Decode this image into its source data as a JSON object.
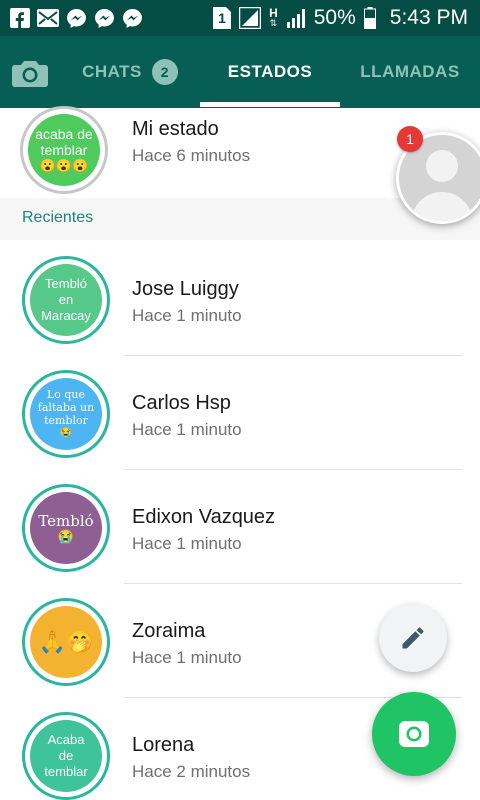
{
  "status_bar": {
    "battery_percent": "50%",
    "time": "5:43 PM",
    "sim_label": "1",
    "network_label": "H",
    "icons": [
      "facebook-icon",
      "mail-icon",
      "messenger-icon",
      "messenger-icon",
      "messenger-icon",
      "sim-icon",
      "signal-icon",
      "signal-icon",
      "battery-icon"
    ]
  },
  "tabs": {
    "camera_icon": "camera-icon",
    "chats_label": "CHATS",
    "chats_badge": "2",
    "estados_label": "ESTADOS",
    "llamadas_label": "LLAMADAS",
    "active": "ESTADOS"
  },
  "my_status": {
    "name": "Mi estado",
    "time": "Hace 6 minutos",
    "thumb_text": "acaba de temblar",
    "thumb_emoji": "😮😮😮",
    "thumb_color": "#4ecb5c"
  },
  "section_title": "Recientes",
  "statuses": [
    {
      "name": "Jose Luiggy",
      "time": "Hace 1 minuto",
      "thumb_text": "Tembló en Maracay",
      "thumb_emoji": "",
      "thumb_color": "#56c88a"
    },
    {
      "name": "Carlos Hsp",
      "time": "Hace 1 minuto",
      "thumb_text": "Lo que faltaba un temblor",
      "thumb_emoji": "😭",
      "thumb_color": "#4db6f2"
    },
    {
      "name": "Edixon Vazquez",
      "time": "Hace 1 minuto",
      "thumb_text": "Tembló",
      "thumb_emoji": "😭",
      "thumb_color": "#8e5f92"
    },
    {
      "name": "Zoraima",
      "time": "Hace 1 minuto",
      "thumb_text": "",
      "thumb_emoji": "🙏🤭",
      "thumb_color": "#f3b330"
    },
    {
      "name": "Lorena",
      "time": "Hace 2 minutos",
      "thumb_text": "Acaba de temblar",
      "thumb_emoji": "",
      "thumb_color": "#3fc39a"
    }
  ],
  "float_profile": {
    "badge": "1",
    "icon": "avatar-placeholder-icon"
  },
  "fab": {
    "edit_icon": "pencil-icon",
    "camera_icon": "camera-icon"
  },
  "colors": {
    "primary": "#075e54",
    "status_bar": "#054d44",
    "accent": "#20c465",
    "ring": "#29b59e"
  }
}
